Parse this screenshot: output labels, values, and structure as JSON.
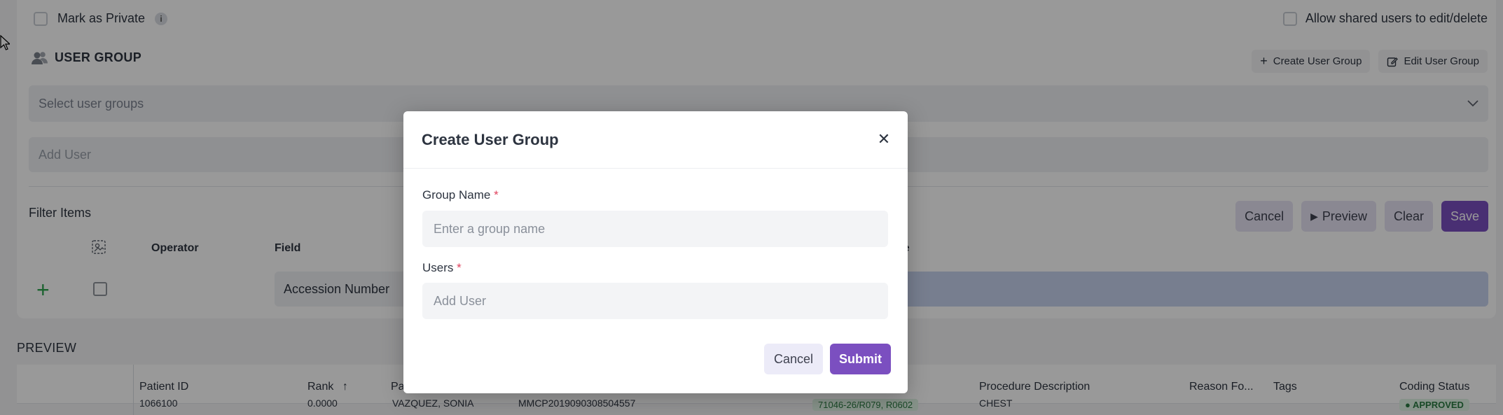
{
  "form": {
    "mark_private_label": "Mark as Private",
    "info_glyph": "i",
    "allow_shared_label": "Allow shared users to edit/delete",
    "user_group_title": "USER GROUP",
    "create_user_group_label": "Create User Group",
    "edit_user_group_label": "Edit User Group",
    "select_user_groups_placeholder": "Select user groups",
    "add_user_placeholder": "Add User"
  },
  "filter": {
    "title": "Filter Items",
    "cancel_label": "Cancel",
    "preview_label": "Preview",
    "clear_label": "Clear",
    "save_label": "Save",
    "col_operator": "Operator",
    "col_field": "Field",
    "col_value_partial": "ue",
    "field_value": "Accession Number"
  },
  "preview": {
    "title": "PREVIEW",
    "columns": [
      "Patient ID",
      "Rank",
      "Pa",
      "Procedure Description",
      "Reason Fo...",
      "Tags",
      "Coding Status"
    ],
    "row": {
      "patient_id": "1066100",
      "rank": "0.0000",
      "patient_name": "VAZQUEZ, SONIA",
      "accession": "MMCP2019090308504557",
      "codes": "71046-26/R079, R0602",
      "procedure": "CHEST",
      "status": "APPROVED"
    }
  },
  "modal": {
    "title": "Create User Group",
    "group_name_label": "Group Name",
    "group_name_placeholder": "Enter a group name",
    "users_label": "Users",
    "users_placeholder": "Add User",
    "required_mark": "*",
    "cancel_label": "Cancel",
    "submit_label": "Submit",
    "close_glyph": "✕"
  },
  "colors": {
    "accent": "#7b4fc0",
    "required": "#e0435e",
    "add_green": "#2ea44f"
  }
}
